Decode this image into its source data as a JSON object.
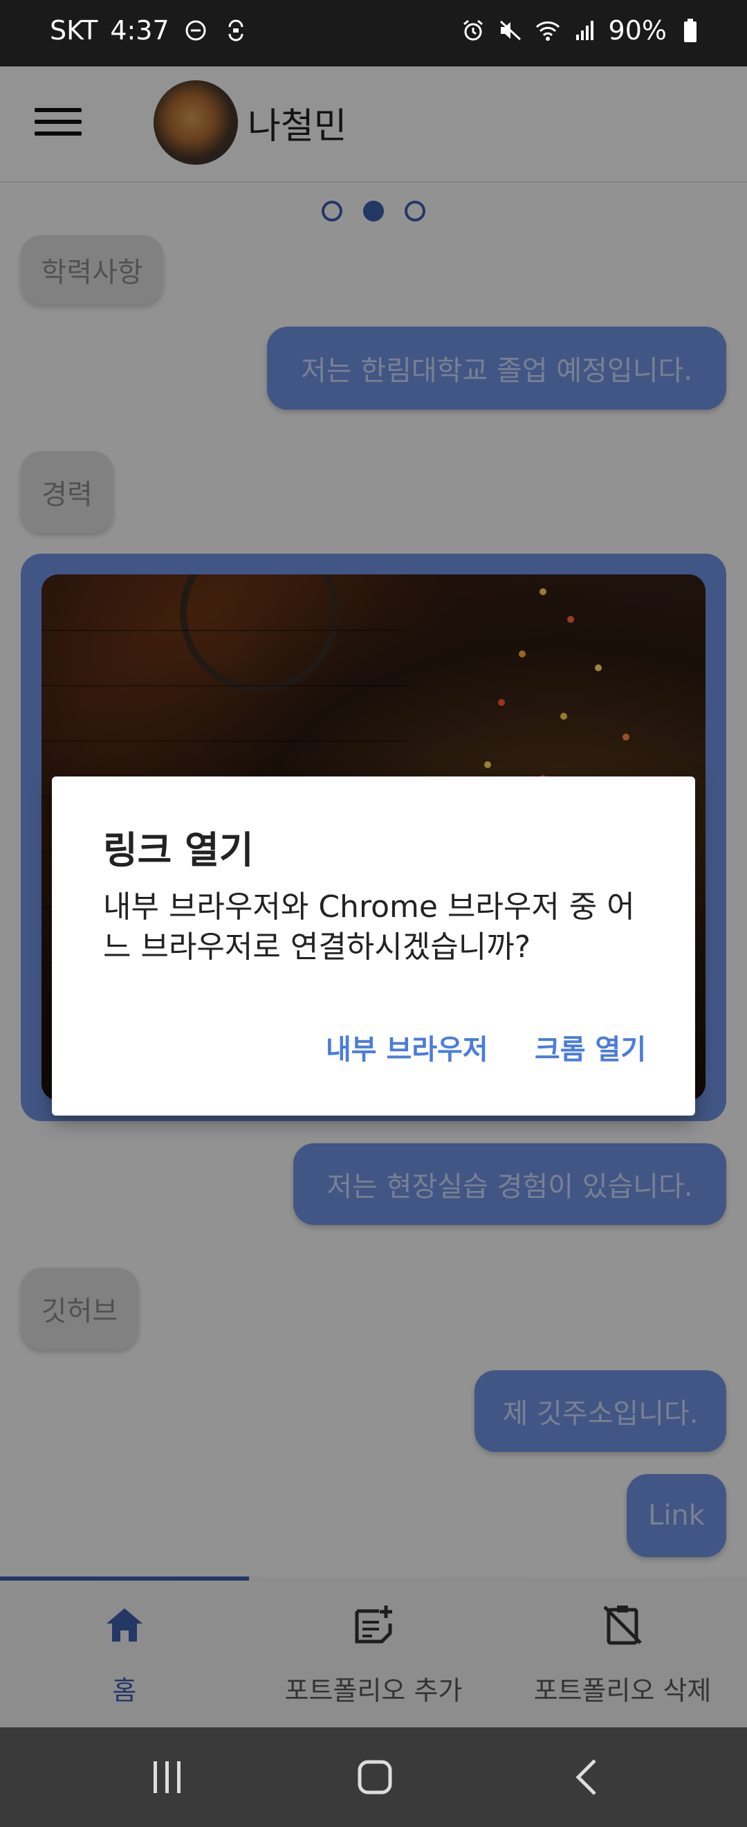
{
  "status_bar": {
    "carrier": "SKT",
    "time": "4:37",
    "battery": "90%",
    "icons": [
      "dnd-icon",
      "sync-icon",
      "alarm-icon",
      "mute-icon",
      "wifi-icon",
      "signal-icon",
      "battery-icon"
    ]
  },
  "header": {
    "name": "나철민"
  },
  "pager": {
    "count": 3,
    "active_index": 1
  },
  "chat": {
    "msg_education_label": "학력사항",
    "msg_education_reply": "저는 한림대학교 졸업 예정입니다.",
    "msg_career_label": "경력",
    "msg_career_reply": "저는 현장실습 경험이 있습니다.",
    "msg_github_label": "깃허브",
    "msg_github_reply": "제 깃주소입니다.",
    "msg_link": "Link"
  },
  "dialog": {
    "title": "링크 열기",
    "message": "내부 브라우저와 Chrome 브라우저 중 어느 브라우저로 연결하시겠습니까?",
    "internal_button": "내부 브라우저",
    "chrome_button": "크롬 열기"
  },
  "bottom_nav": {
    "items": [
      {
        "label": "홈",
        "icon": "home-icon",
        "active": true
      },
      {
        "label": "포트폴리오 추가",
        "icon": "note-add-icon",
        "active": false
      },
      {
        "label": "포트폴리오 삭제",
        "icon": "clipboard-off-icon",
        "active": false
      }
    ]
  },
  "colors": {
    "accent": "#3c5ca8",
    "bubble_right": "#6f90de",
    "dialog_button": "#4a7cdc"
  }
}
